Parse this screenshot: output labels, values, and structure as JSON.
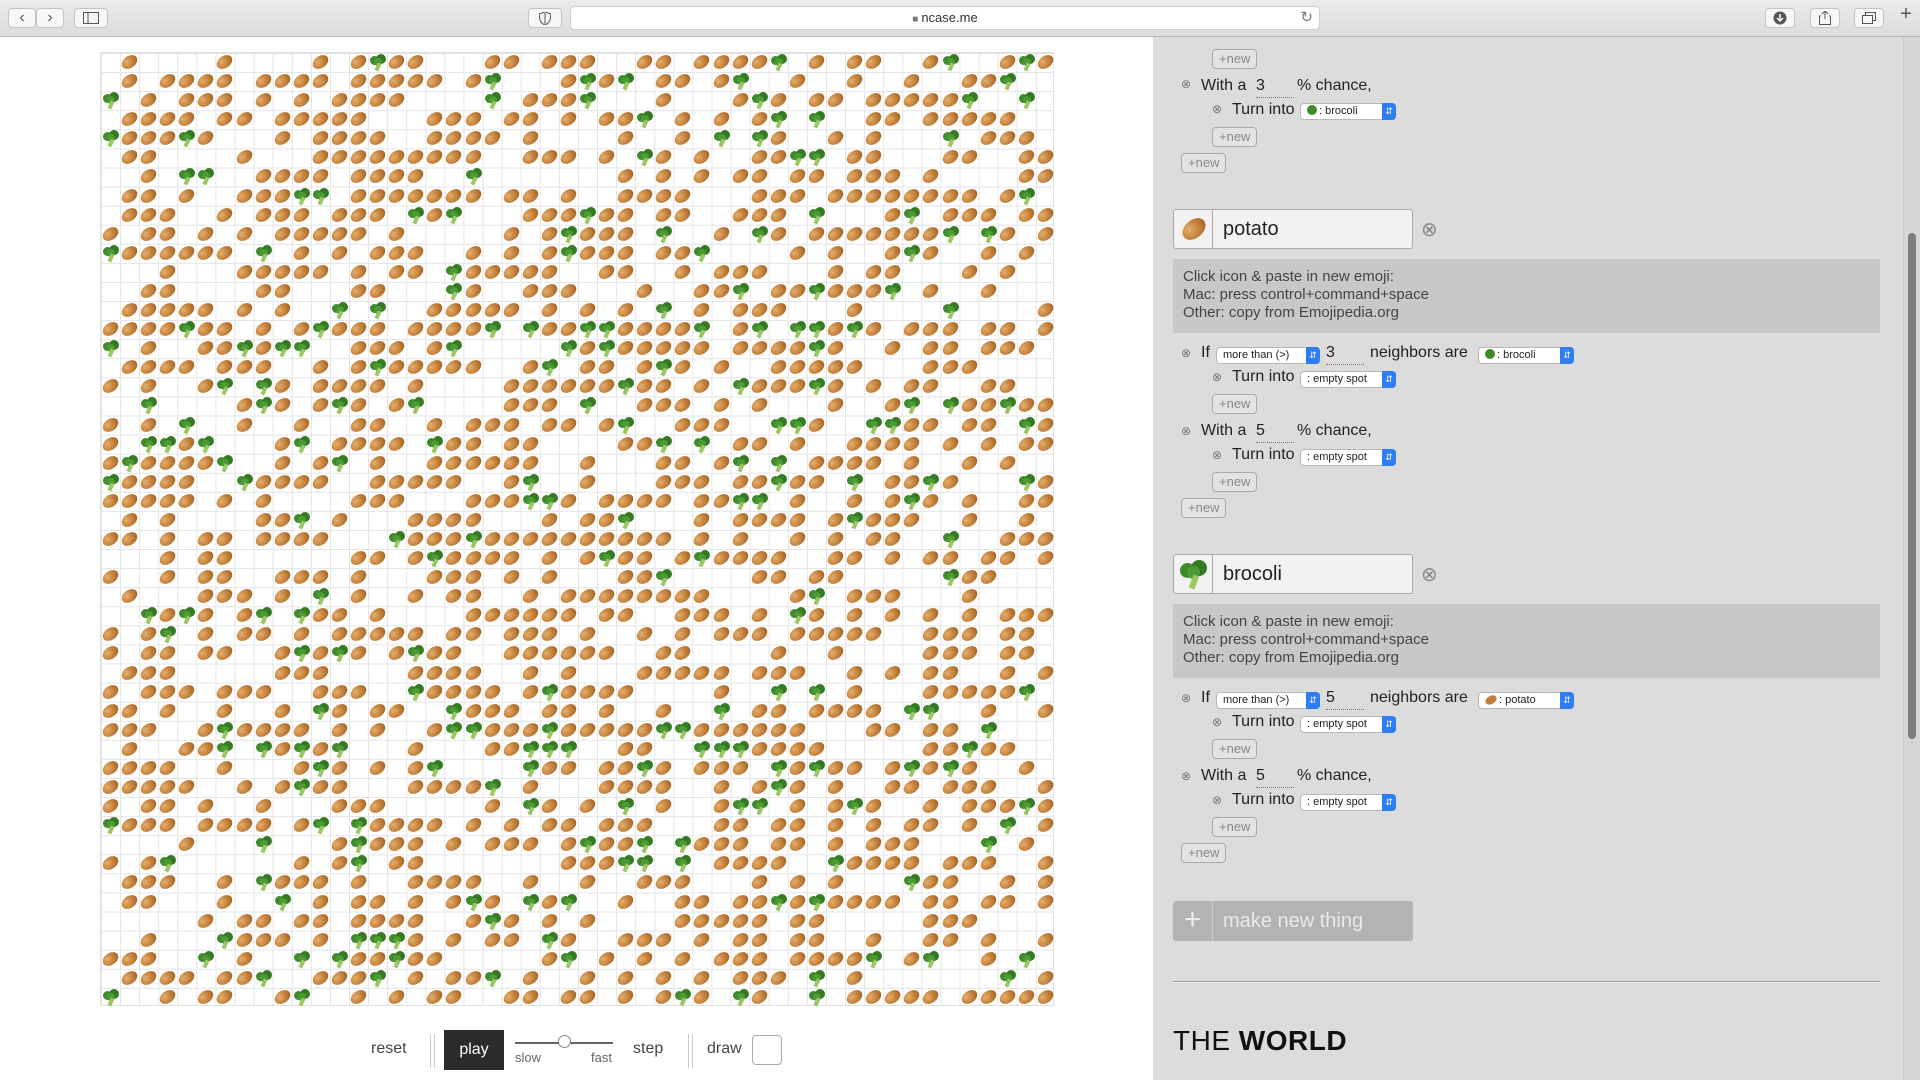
{
  "browser": {
    "url": "ncase.me",
    "back_icon": "‹",
    "forward_icon": "›",
    "lock_icon": "🔒",
    "reload_icon": "↻"
  },
  "simulation": {
    "grid_cols": 50,
    "grid_rows": 50,
    "controls": {
      "reset": "reset",
      "play": "play",
      "slow": "slow",
      "fast": "fast",
      "step": "step",
      "draw": "draw",
      "speed_fraction": 0.5
    }
  },
  "editor": {
    "top_partial": {
      "new_label": "+new",
      "chance_prefix": "With a",
      "chance_value": "3",
      "chance_suffix": "% chance,",
      "turn_into": "Turn into",
      "turn_into_value": "brocoli",
      "new_label_2": "+new",
      "new_label_3": "+new"
    },
    "things": [
      {
        "name": "potato",
        "help_line1": "Click icon & paste in new emoji:",
        "help_line2": "Mac: press control+command+space",
        "help_line3": "Other: copy from Emojipedia.org",
        "if_label": "If",
        "comparison": "more than (>)",
        "neighbor_count": "3",
        "neighbors_are": "neighbors are",
        "neighbor_thing": "brocoli",
        "turn_into": "Turn into",
        "turn_into_value": "empty spot",
        "new_label": "+new",
        "chance_prefix": "With a",
        "chance_value": "5",
        "chance_suffix": "% chance,",
        "turn_into_2": "Turn into",
        "turn_into_value_2": "empty spot",
        "new_label_2": "+new",
        "new_label_3": "+new"
      },
      {
        "name": "brocoli",
        "help_line1": "Click icon & paste in new emoji:",
        "help_line2": "Mac: press control+command+space",
        "help_line3": "Other: copy from Emojipedia.org",
        "if_label": "If",
        "comparison": "more than (>)",
        "neighbor_count": "5",
        "neighbors_are": "neighbors are",
        "neighbor_thing": "potato",
        "turn_into": "Turn into",
        "turn_into_value": "empty spot",
        "new_label": "+new",
        "chance_prefix": "With a",
        "chance_value": "5",
        "chance_suffix": "% chance,",
        "turn_into_2": "Turn into",
        "turn_into_value_2": "empty spot",
        "new_label_2": "+new",
        "new_label_3": "+new"
      }
    ],
    "make_new_thing": "make new thing",
    "world_title_light": "THE",
    "world_title_bold": "WORLD"
  },
  "colors": {
    "potato": "#b6732f",
    "brocoli": "#3f8a2a",
    "select_accent": "#2f7df2",
    "panel_bg": "#dcdcdc"
  }
}
